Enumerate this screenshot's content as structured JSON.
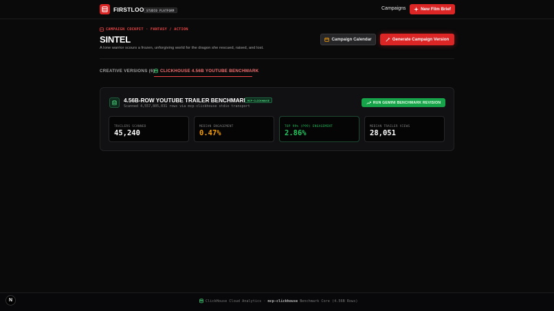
{
  "header": {
    "brand": "FIRSTLOOK",
    "badge": "STUDIO PLATFORM",
    "nav_campaigns": "Campaigns",
    "new_brief": "New Film Brief"
  },
  "page": {
    "breadcrumb": "CAMPAIGN COCKPIT · FANTASY / ACTION",
    "title": "SINTEL",
    "subtitle": "A lone warrior scours a frozen, unforgiving world for the dragon she rescued, raised, and lost.",
    "calendar_button": "Campaign Calendar",
    "generate_button": "Generate Campaign Version"
  },
  "tabs": [
    {
      "label": "CREATIVE VERSIONS (6)",
      "active": false
    },
    {
      "label": "CLICKHOUSE 4.56B YOUTUBE BENCHMARK",
      "active": true
    }
  ],
  "panel": {
    "title": "4.56B-ROW YOUTUBE TRAILER BENCHMARK",
    "badge": "MCP-CLICKHOUSE",
    "subtitle": "Scanned 4,557,805,031 rows via mcp-clickhouse stdio transport",
    "action": "RUN GEMINI BENCHMARK REVISION"
  },
  "stats": [
    {
      "label": "TRAILERS SCANNED",
      "value": "45,240",
      "color": "#ffffff"
    },
    {
      "label": "MEDIAN ENGAGEMENT",
      "value": "0.47%",
      "color": "#f59e0b"
    },
    {
      "label": "TOP 99% (P99) ENGAGEMENT",
      "value": "2.86%",
      "color": "#22c55e"
    },
    {
      "label": "MEDIAN TRAILER VIEWS",
      "value": "28,051",
      "color": "#ffffff"
    }
  ],
  "footer": {
    "prefix": "ClickHouse Cloud Analytics ·",
    "strong": "mcp-clickhouse",
    "suffix": "Benchmark Core (4.56B Rows)"
  },
  "colors": {
    "accent_red": "#dc2626",
    "accent_green": "#16a34a",
    "background": "#0a0a0b"
  }
}
